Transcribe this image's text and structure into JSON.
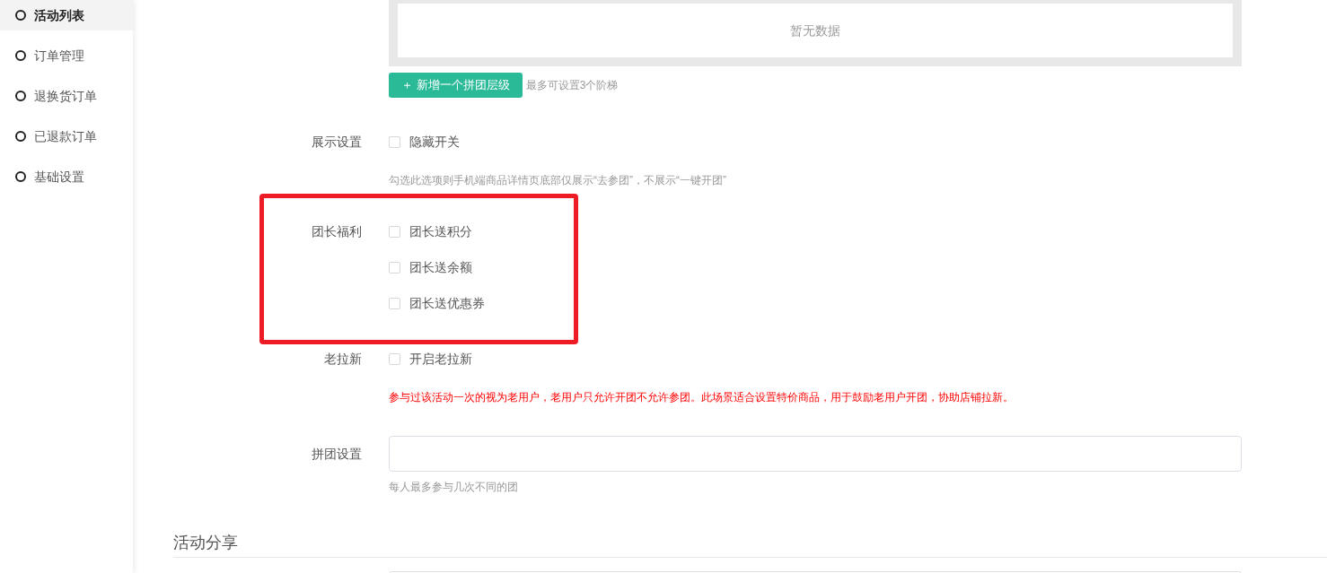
{
  "sidebar": {
    "items": [
      {
        "label": "活动列表",
        "selected": true
      },
      {
        "label": "订单管理",
        "selected": false
      },
      {
        "label": "退换货订单",
        "selected": false
      },
      {
        "label": "已退款订单",
        "selected": false
      },
      {
        "label": "基础设置",
        "selected": false
      }
    ]
  },
  "tier_table": {
    "empty_text": "暂无数据"
  },
  "add_tier": {
    "button": "＋ 新增一个拼团层级",
    "hint": "最多可设置3个阶梯"
  },
  "form": [
    {
      "kind": "checkboxes",
      "label": "展示设置",
      "options": [
        {
          "label": "隐藏开关",
          "checked": false
        }
      ],
      "hint": "勾选此选项则手机端商品详情页底部仅展示“去参团”，不展示“一键开团”",
      "hint_warning": false,
      "highlighted": false
    },
    {
      "kind": "checkboxes",
      "label": "团长福利",
      "options": [
        {
          "label": "团长送积分",
          "checked": false
        },
        {
          "label": "团长送余额",
          "checked": false
        },
        {
          "label": "团长送优惠券",
          "checked": false
        }
      ],
      "highlighted": true
    },
    {
      "kind": "checkboxes",
      "label": "老拉新",
      "options": [
        {
          "label": "开启老拉新",
          "checked": false
        }
      ],
      "hint": "参与过该活动一次的视为老用户，老用户只允许开团不允许参团。此场景适合设置特价商品，用于鼓励老用户开团，协助店铺拉新。",
      "hint_warning": true,
      "highlighted": false
    },
    {
      "kind": "input",
      "label": "拼团设置",
      "hint": "每人最多参与几次不同的团",
      "hint_warning": false,
      "highlighted": false
    }
  ],
  "section": {
    "title": "活动分享"
  }
}
